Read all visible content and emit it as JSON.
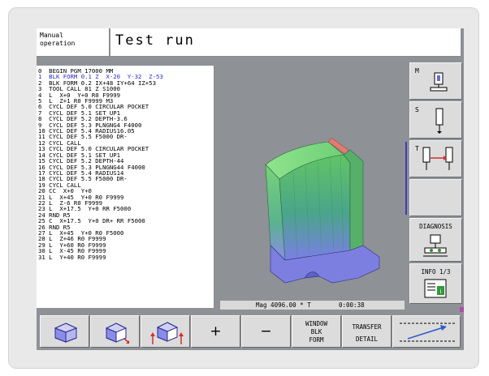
{
  "header": {
    "mode_line1": "Manual",
    "mode_line2": "operation",
    "title": "Test run"
  },
  "program": {
    "lines": [
      "0  BEGIN PGM 17000 MM",
      "1  BLK FORM 0.1 Z  X-20  Y-32  Z-53",
      "2  BLK FORM 0.2 IX+48 IY+64 IZ+53",
      "3  TOOL CALL 81 Z S1000",
      "4  L  X+0  Y+0 R0 F9999",
      "5  L  Z+1 R0 F9999 M3",
      "6  CYCL DEF 5.0 CIRCULAR POCKET",
      "7  CYCL DEF 5.1 SET UP1",
      "8  CYCL DEF 5.2 DEPTH-3.6",
      "9  CYCL DEF 5.3 PLNGNG4 F4000",
      "10 CYCL DEF 5.4 RADIUS16.05",
      "11 CYCL DEF 5.5 F5000 DR-",
      "12 CYCL CALL",
      "13 CYCL DEF 5.0 CIRCULAR POCKET",
      "14 CYCL DEF 5.1 SET UP1",
      "15 CYCL DEF 5.2 DEPTH-44",
      "16 CYCL DEF 5.3 PLNGNG44 F4000",
      "17 CYCL DEF 5.4 RADIUS14",
      "18 CYCL DEF 5.5 F5000 DR-",
      "19 CYCL CALL",
      "20 CC  X+0  Y+0",
      "21 L  X+45  Y+0 R0 F9999",
      "22 L  Z-6 R0 F9999",
      "23 L  X+17.5  Y+0 RR F5000",
      "24 RND R5",
      "25 C  X+17.5  Y+0 DR+ RR F5000",
      "26 RND R5",
      "27 L  X+45  Y+0 R0 F5000",
      "28 L  Z+46 R0 F9999",
      "29 L  Y+60 R0 F9999",
      "30 L  X-45 R0 F9999",
      "31 L  Y+40 R0 F9999"
    ],
    "highlighted_index": 1
  },
  "status": {
    "magnification": "Mag 4096.00 * T",
    "time": "0:00:38"
  },
  "sidebar": {
    "m_label": "M",
    "s_label": "S",
    "t_label": "T",
    "diagnosis_label": "DIAGNOSIS",
    "info_label": "INFO 1/3"
  },
  "bottom": {
    "plus_label": "+",
    "minus_label": "−",
    "window_line1": "WINDOW",
    "window_line2": "BLK",
    "window_line3": "FORM",
    "transfer_line1": "TRANSFER",
    "transfer_line2": "DETAIL"
  },
  "colors": {
    "highlight_text": "#2c2cc8",
    "screen_background": "#8e9196",
    "softkey_face": "#dcdcdc",
    "part_green": "#5fb36a",
    "part_blue": "#7d7fe0",
    "part_red": "#e07a73"
  },
  "icons": {
    "m_key": "machine-spindle-icon",
    "s_key": "spindle-speed-icon",
    "t_key": "tool-icon",
    "diagnosis_key": "diagnosis-icon",
    "info_key": "info-screen-icon",
    "view1": "3d-view-icon",
    "view2": "rotate-view-icon",
    "view3": "tilt-view-icon",
    "pager": "pager-arrow-icon"
  }
}
